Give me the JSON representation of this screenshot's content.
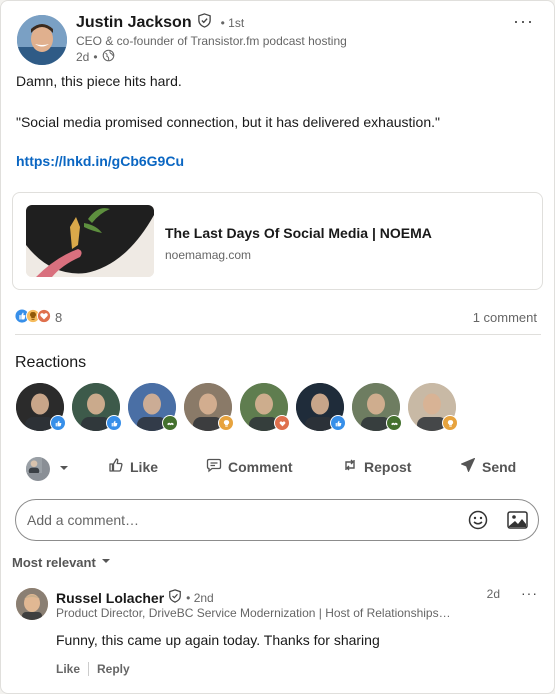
{
  "post": {
    "author": "Justin Jackson",
    "degree": "1st",
    "headline": "CEO & co-founder of Transistor.fm podcast hosting",
    "time": "2d",
    "more": "···",
    "line1": "Damn, this piece hits hard.",
    "line2": "\"Social media promised connection, but it has delivered exhaustion.\"",
    "link": "https://lnkd.in/gCb6G9Cu"
  },
  "article": {
    "title": "The Last Days Of Social Media | NOEMA",
    "domain": "noemamag.com"
  },
  "stats": {
    "reaction_count": "8",
    "comment_count": "1 comment"
  },
  "reactions": {
    "title": "Reactions",
    "people": [
      {
        "color": "#2b2b2b",
        "badge": "like",
        "badge_color": "#378fe9"
      },
      {
        "color": "#3d5a4a",
        "badge": "like",
        "badge_color": "#378fe9"
      },
      {
        "color": "#4a6fa5",
        "badge": "support",
        "badge_color": "#44712e"
      },
      {
        "color": "#8a7a68",
        "badge": "insightful",
        "badge_color": "#e7a33e"
      },
      {
        "color": "#5f7d4f",
        "badge": "love",
        "badge_color": "#df704d"
      },
      {
        "color": "#1f2c3a",
        "badge": "like",
        "badge_color": "#378fe9"
      },
      {
        "color": "#6e7d61",
        "badge": "support",
        "badge_color": "#44712e"
      },
      {
        "color": "#c8b9a5",
        "badge": "insightful",
        "badge_color": "#e7a33e"
      }
    ]
  },
  "actions": {
    "like": "Like",
    "comment": "Comment",
    "repost": "Repost",
    "send": "Send"
  },
  "comment_box": {
    "placeholder": "Add a comment…"
  },
  "sort": {
    "label": "Most relevant"
  },
  "comment": {
    "author": "Russel Lolacher",
    "degree": "2nd",
    "headline": "Product Director, DriveBC Service Modernization | Host of Relationships…",
    "time": "2d",
    "more": "···",
    "text": "Funny, this came up again today. Thanks for sharing",
    "like": "Like",
    "reply": "Reply"
  },
  "colors": {
    "link": "#0a66c2",
    "like": "#378fe9",
    "love": "#df704d",
    "insightful": "#e7a33e",
    "support": "#44712e"
  }
}
